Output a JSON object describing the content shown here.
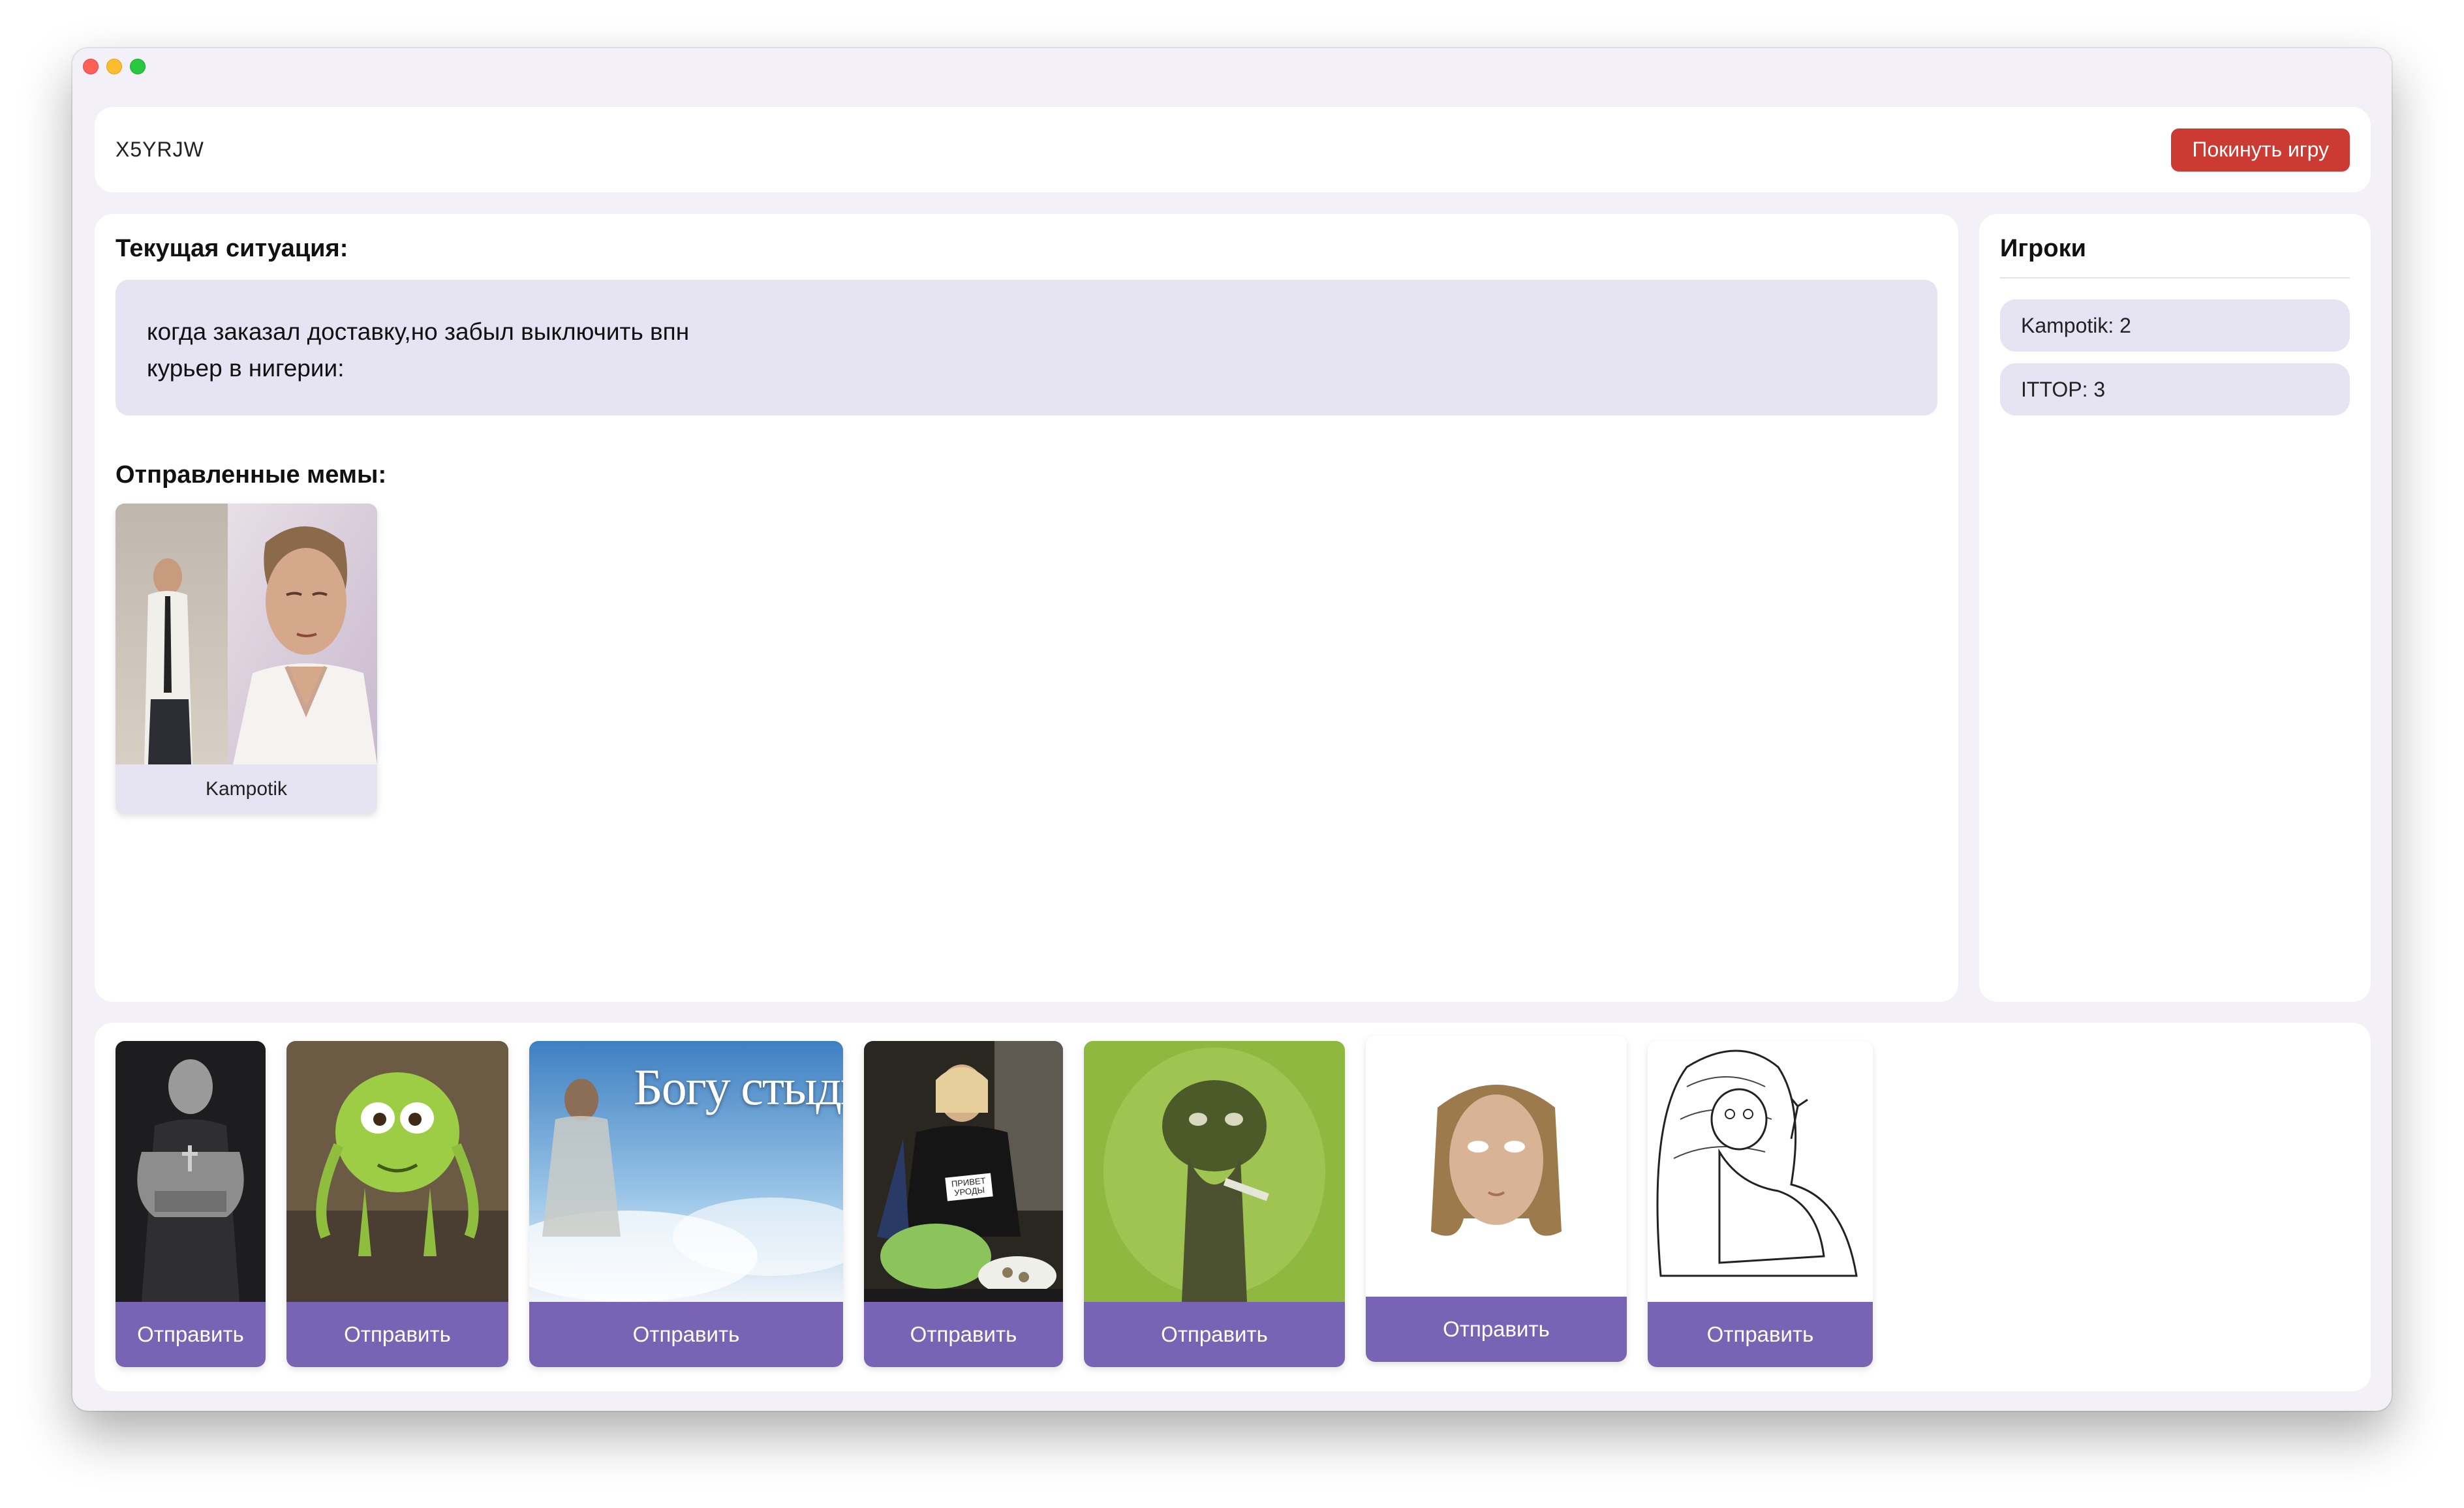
{
  "topbar": {
    "room_code": "X5YRJW",
    "leave_label": "Покинуть игру"
  },
  "situation": {
    "heading": "Текущая ситуация:",
    "line1": "когда заказал доставку,но забыл выключить впн",
    "line2": "курьер в нигерии:"
  },
  "sent": {
    "heading": "Отправленные мемы:",
    "memes": [
      {
        "author": "Kampotik"
      }
    ]
  },
  "players": {
    "heading": "Игроки",
    "list": [
      {
        "label": "Kampotik: 2"
      },
      {
        "label": "ITTOP: 3"
      }
    ]
  },
  "hand": {
    "send_label": "Отправить",
    "meme3_caption": "Богу стыдно",
    "meme4_sign": "ПРИВЕТ УРОДЫ"
  },
  "colors": {
    "accent": "#7863b4",
    "danger": "#cc3a34",
    "soft": "#e6e3f2",
    "background": "#f3f1f7"
  }
}
